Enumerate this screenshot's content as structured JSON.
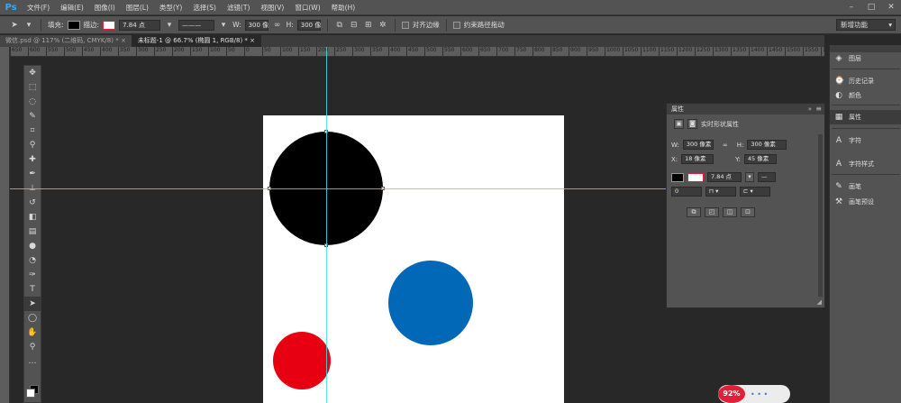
{
  "app": {
    "logo": "Ps"
  },
  "menu": [
    "文件(F)",
    "编辑(E)",
    "图像(I)",
    "图层(L)",
    "类型(Y)",
    "选择(S)",
    "滤镜(T)",
    "视图(V)",
    "窗口(W)",
    "帮助(H)"
  ],
  "window_controls": [
    "–",
    "□",
    "✕"
  ],
  "options": {
    "fill_label": "填充:",
    "stroke_label": "描边:",
    "stroke_width": "7.84 点",
    "w_label": "W:",
    "w_value": "300 像",
    "link_icon": "∞",
    "h_label": "H:",
    "h_value": "300 像",
    "align_edges": "对齐边缘",
    "constrain_path": "约束路径拖动",
    "workspace": "新增功能",
    "fill_color": "#000000",
    "stroke_color": "#e0203a"
  },
  "tabs": [
    {
      "label": "微信.psd @ 117% (二维码, CMYK/8) *",
      "close": "×"
    },
    {
      "label": "未标题-1 @ 66.7% (椭圆 1, RGB/8) *",
      "close": "×"
    }
  ],
  "ruler": [
    "650",
    "600",
    "550",
    "500",
    "450",
    "400",
    "350",
    "300",
    "250",
    "200",
    "150",
    "100",
    "50",
    "0",
    "50",
    "100",
    "150",
    "200",
    "250",
    "300",
    "350",
    "400",
    "450",
    "500",
    "550",
    "600",
    "650",
    "700",
    "750",
    "800",
    "850",
    "900",
    "950",
    "1000",
    "1050",
    "1100",
    "1150",
    "1200",
    "1250",
    "1300",
    "1350",
    "1400",
    "1450",
    "1500",
    "1550",
    "1600"
  ],
  "tools": [
    {
      "name": "move-tool",
      "glyph": "✥"
    },
    {
      "name": "marquee-tool",
      "glyph": "⬚"
    },
    {
      "name": "lasso-tool",
      "glyph": "◌"
    },
    {
      "name": "quick-select-tool",
      "glyph": "✎"
    },
    {
      "name": "crop-tool",
      "glyph": "⌗"
    },
    {
      "name": "eyedropper-tool",
      "glyph": "⚲"
    },
    {
      "name": "healing-tool",
      "glyph": "✚"
    },
    {
      "name": "brush-tool",
      "glyph": "✒"
    },
    {
      "name": "stamp-tool",
      "glyph": "⊥"
    },
    {
      "name": "history-brush-tool",
      "glyph": "↺"
    },
    {
      "name": "eraser-tool",
      "glyph": "◧"
    },
    {
      "name": "gradient-tool",
      "glyph": "▤"
    },
    {
      "name": "blur-tool",
      "glyph": "●"
    },
    {
      "name": "dodge-tool",
      "glyph": "◔"
    },
    {
      "name": "pen-tool",
      "glyph": "✑"
    },
    {
      "name": "type-tool",
      "glyph": "T"
    },
    {
      "name": "path-select-tool",
      "glyph": "➤"
    },
    {
      "name": "ellipse-tool",
      "glyph": "◯"
    },
    {
      "name": "hand-tool",
      "glyph": "✋"
    },
    {
      "name": "zoom-tool",
      "glyph": "⚲"
    },
    {
      "name": "more-tools",
      "glyph": "…"
    }
  ],
  "canvas": {
    "circles": [
      {
        "name": "black-circle",
        "color": "#000000"
      },
      {
        "name": "blue-circle",
        "color": "#0068b7"
      },
      {
        "name": "red-circle",
        "color": "#e60012"
      }
    ]
  },
  "properties": {
    "title": "属性",
    "collapse": "»",
    "menu_icon": "≡",
    "section_title": "实时形状属性",
    "w_label": "W:",
    "w_value": "300 像素",
    "link_icon": "∞",
    "h_label": "H:",
    "h_value": "300 像素",
    "x_label": "X:",
    "x_value": "18 像素",
    "y_label": "Y:",
    "y_value": "45 像素",
    "stroke_width": "7.84 点",
    "align_value": "0"
  },
  "dock": [
    {
      "name": "layers",
      "icon": "◈",
      "label": "图层"
    },
    {
      "name": "history",
      "icon": "⌚",
      "label": "历史记录"
    },
    {
      "name": "color",
      "icon": "◐",
      "label": "颜色"
    },
    {
      "name": "properties",
      "icon": "▦",
      "label": "属性"
    },
    {
      "name": "character",
      "icon": "A",
      "label": "字符"
    },
    {
      "name": "character-styles",
      "icon": "A",
      "label": "字符样式"
    },
    {
      "name": "brush",
      "icon": "✎",
      "label": "画笔"
    },
    {
      "name": "brush-presets",
      "icon": "⚒",
      "label": "画笔预设"
    }
  ],
  "zoom_badge": {
    "percent": "92%",
    "dots": "• • •"
  }
}
